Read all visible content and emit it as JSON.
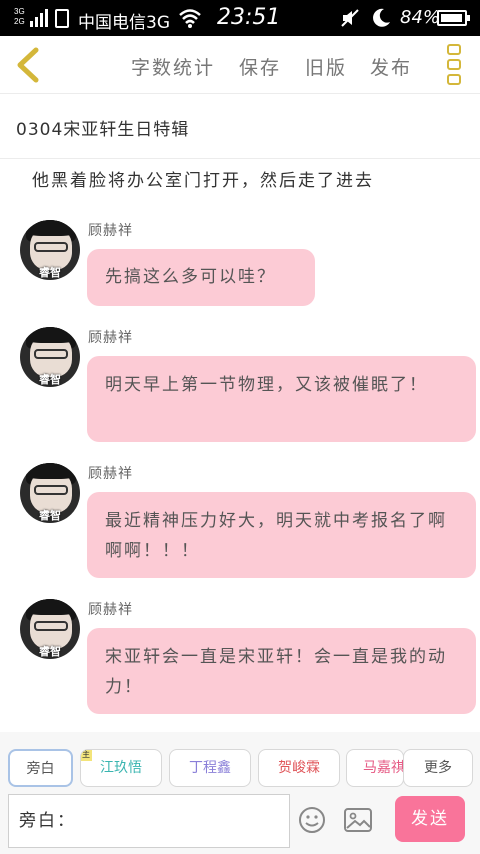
{
  "status_bar": {
    "network_top": "3G",
    "network_bottom": "2G",
    "carrier": "中国电信3G",
    "time": "23:51",
    "battery_pct": "84%"
  },
  "toolbar": {
    "word_count": "字数统计",
    "save": "保存",
    "old_version": "旧版",
    "publish": "发布"
  },
  "title": "0304宋亚轩生日特辑",
  "narration": "他黑着脸将办公室门打开，然后走了进去",
  "messages": [
    {
      "sender": "顾赫祥",
      "avatar_caption": "睿智",
      "text": "先搞这么多可以哇？"
    },
    {
      "sender": "顾赫祥",
      "avatar_caption": "睿智",
      "text": "明天早上第一节物理，又该被催眠了！"
    },
    {
      "sender": "顾赫祥",
      "avatar_caption": "睿智",
      "text": "最近精神压力好大，明天就中考报名了啊啊啊！！！"
    },
    {
      "sender": "顾赫祥",
      "avatar_caption": "睿智",
      "text": "宋亚轩会一直是宋亚轩！会一直是我的动力！"
    }
  ],
  "roles": [
    {
      "label": "旁白",
      "color": "#555555"
    },
    {
      "label": "江玖悟",
      "color": "#3ab5b0",
      "badge": "主"
    },
    {
      "label": "丁程鑫",
      "color": "#8a7fd8"
    },
    {
      "label": "贺峻霖",
      "color": "#e0575b"
    },
    {
      "label": "马嘉祺",
      "color": "#e65a84"
    }
  ],
  "more_roles": "更多",
  "input": {
    "value": "旁白：",
    "send": "发送"
  },
  "colors": {
    "bubble": "#fccbd5",
    "send_button": "#f9749a",
    "back_arrow": "#d4b73a"
  }
}
